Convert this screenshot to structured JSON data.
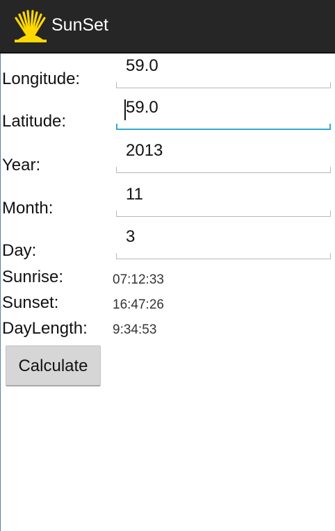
{
  "app": {
    "title": "SunSet",
    "icon": "sunrise-logo-icon",
    "colors": {
      "actionbar": "#262626",
      "accent": "#33a9d4",
      "icon_yellow": "#ffd800"
    }
  },
  "form": {
    "longitude": {
      "label": "Longitude:",
      "value": "59.0"
    },
    "latitude": {
      "label": "Latitude:",
      "value": "59.0"
    },
    "year": {
      "label": "Year:",
      "value": "2013"
    },
    "month": {
      "label": "Month:",
      "value": "11"
    },
    "day": {
      "label": "Day:",
      "value": "3"
    }
  },
  "results": {
    "sunrise": {
      "label": "Sunrise:",
      "value": "07:12:33"
    },
    "sunset": {
      "label": "Sunset:",
      "value": "16:47:26"
    },
    "daylength": {
      "label": "DayLength:",
      "value": "9:34:53"
    }
  },
  "actions": {
    "calculate_label": "Calculate"
  }
}
